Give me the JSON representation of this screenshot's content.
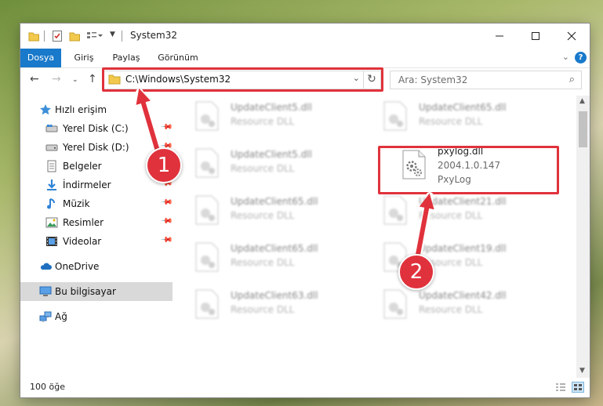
{
  "window": {
    "title": "System32"
  },
  "ribbon": {
    "tabs": [
      {
        "label": "Dosya"
      },
      {
        "label": "Giriş"
      },
      {
        "label": "Paylaş"
      },
      {
        "label": "Görünüm"
      }
    ]
  },
  "address": {
    "path": "C:\\Windows\\System32"
  },
  "search": {
    "placeholder": "Ara: System32"
  },
  "sidebar": {
    "quick_access": "Hızlı erişim",
    "items": [
      {
        "label": "Yerel Disk (C:)"
      },
      {
        "label": "Yerel Disk (D:)"
      },
      {
        "label": "Belgeler"
      },
      {
        "label": "İndirmeler"
      },
      {
        "label": "Müzik"
      },
      {
        "label": "Resimler"
      },
      {
        "label": "Videolar"
      }
    ],
    "onedrive": "OneDrive",
    "this_pc": "Bu bilgisayar",
    "network": "Ağ"
  },
  "files": {
    "highlighted": {
      "name": "pxylog.dll",
      "version": "2004.1.0.147",
      "company": "PxyLog"
    },
    "blurred": [
      {
        "name": "UpdateClient5.dll",
        "type": "Resource DLL"
      },
      {
        "name": "UpdateClient65.dll",
        "type": "Resource DLL"
      },
      {
        "name": "UpdateClient5.dll",
        "type": "Resource DLL"
      },
      {
        "name": "UpdateClient65.dll",
        "type": "Resource DLL"
      },
      {
        "name": "UpdateClient21.dll",
        "type": "Resource DLL"
      },
      {
        "name": "UpdateClient65.dll",
        "type": "Resource DLL"
      },
      {
        "name": "UpdateClient19.dll",
        "type": "Resource DLL"
      },
      {
        "name": "UpdateClient63.dll",
        "type": "Resource DLL"
      },
      {
        "name": "UpdateClient42.dll",
        "type": "Resource DLL"
      }
    ]
  },
  "status": {
    "item_count": "100 öğe"
  },
  "callouts": {
    "step1": "1",
    "step2": "2"
  },
  "colors": {
    "accent": "#1979ca",
    "highlight_red": "#e0323c"
  }
}
